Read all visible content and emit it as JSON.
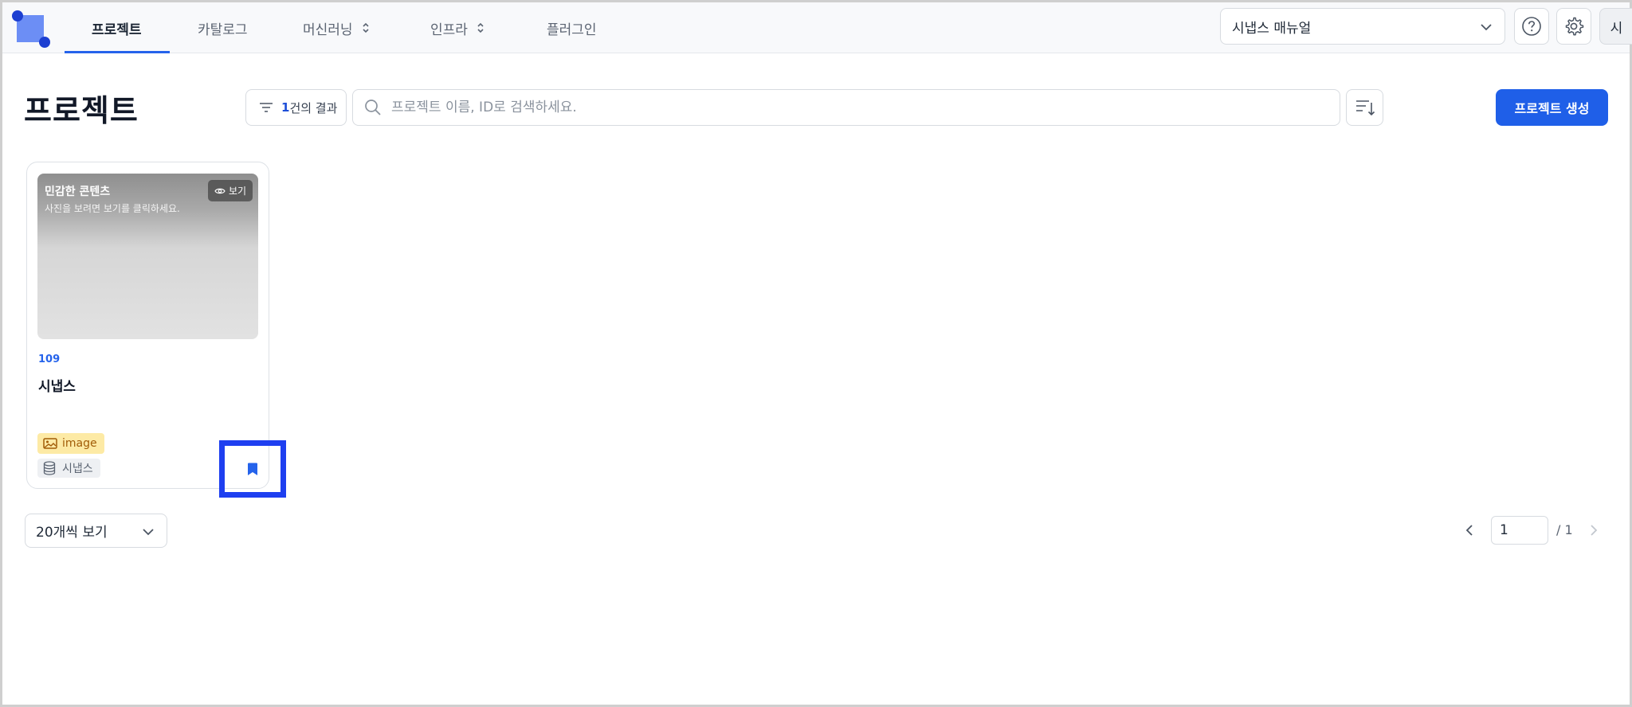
{
  "nav": {
    "items": [
      {
        "label": "프로젝트",
        "active": true
      },
      {
        "label": "카탈로그"
      },
      {
        "label": "머신러닝"
      },
      {
        "label": "인프라"
      },
      {
        "label": "플러그인"
      }
    ],
    "manual_select": "시냅스 매뉴얼",
    "avatar_initial": "시"
  },
  "header": {
    "title": "프로젝트",
    "result_count": "1",
    "result_suffix": "건의 결과",
    "search_placeholder": "프로젝트 이름, ID로 검색하세요.",
    "create_label": "프로젝트 생성"
  },
  "card": {
    "thumb_title": "민감한 콘텐츠",
    "thumb_sub": "사진을 보려면 보기를 클릭하세요.",
    "view_label": "보기",
    "id": "109",
    "name": "시냅스",
    "tag_type": "image",
    "tag_dataset": "시냅스"
  },
  "footer": {
    "page_size_label": "20개씩 보기",
    "current_page": "1",
    "total_pages": "/ 1"
  },
  "colors": {
    "accent": "#1f5fe8",
    "highlight_box": "#1e3ff0",
    "tag_image_bg": "#fdeaa5"
  }
}
